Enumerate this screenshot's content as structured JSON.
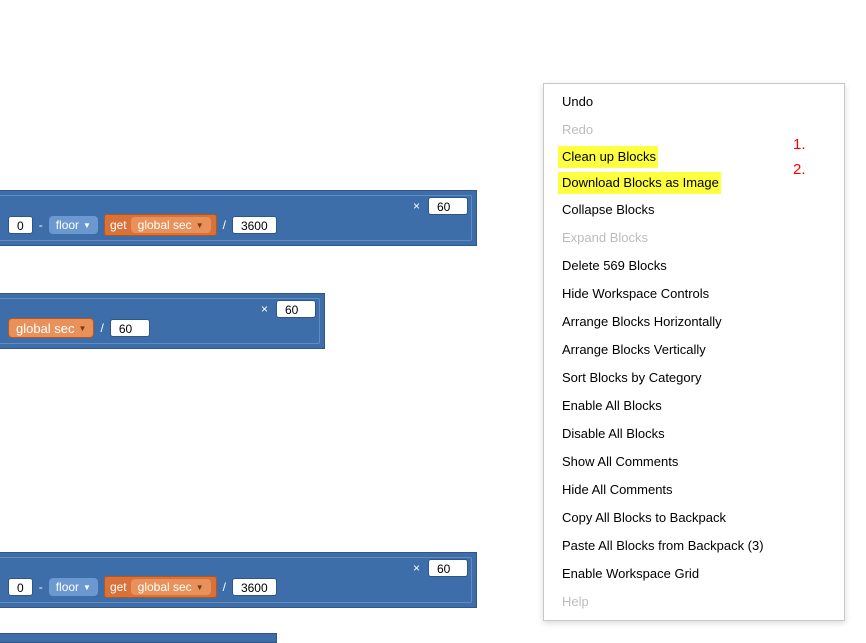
{
  "blocks": {
    "row1": {
      "op_minus": "-",
      "floor_label": "floor",
      "get_label": "get",
      "var_label": "global sec",
      "op_div": "/",
      "divisor": "3600",
      "op_mul": "×",
      "mul_val": "60"
    },
    "row2": {
      "var_label": "global sec",
      "op_div": "/",
      "divisor": "60",
      "op_mul": "×",
      "mul_val": "60"
    },
    "row3": {
      "op_minus": "-",
      "floor_label": "floor",
      "get_label": "get",
      "var_label": "global sec",
      "op_div": "/",
      "divisor": "3600",
      "op_mul": "×",
      "mul_val": "60"
    }
  },
  "menu": {
    "undo": "Undo",
    "redo": "Redo",
    "cleanup": "Clean up Blocks",
    "download": "Download Blocks as Image",
    "collapse": "Collapse Blocks",
    "expand": "Expand Blocks",
    "delete": "Delete 569 Blocks",
    "hide_ctrls": "Hide Workspace Controls",
    "arr_h": "Arrange Blocks Horizontally",
    "arr_v": "Arrange Blocks Vertically",
    "sort": "Sort Blocks by Category",
    "enable_all": "Enable All Blocks",
    "disable_all": "Disable All Blocks",
    "show_comments": "Show All Comments",
    "hide_comments": "Hide All Comments",
    "copy_backpack": "Copy All Blocks to Backpack",
    "paste_backpack": "Paste All Blocks from Backpack (3)",
    "enable_grid": "Enable Workspace Grid",
    "help": "Help"
  },
  "annotations": {
    "a1": "1.",
    "a2": "2."
  }
}
